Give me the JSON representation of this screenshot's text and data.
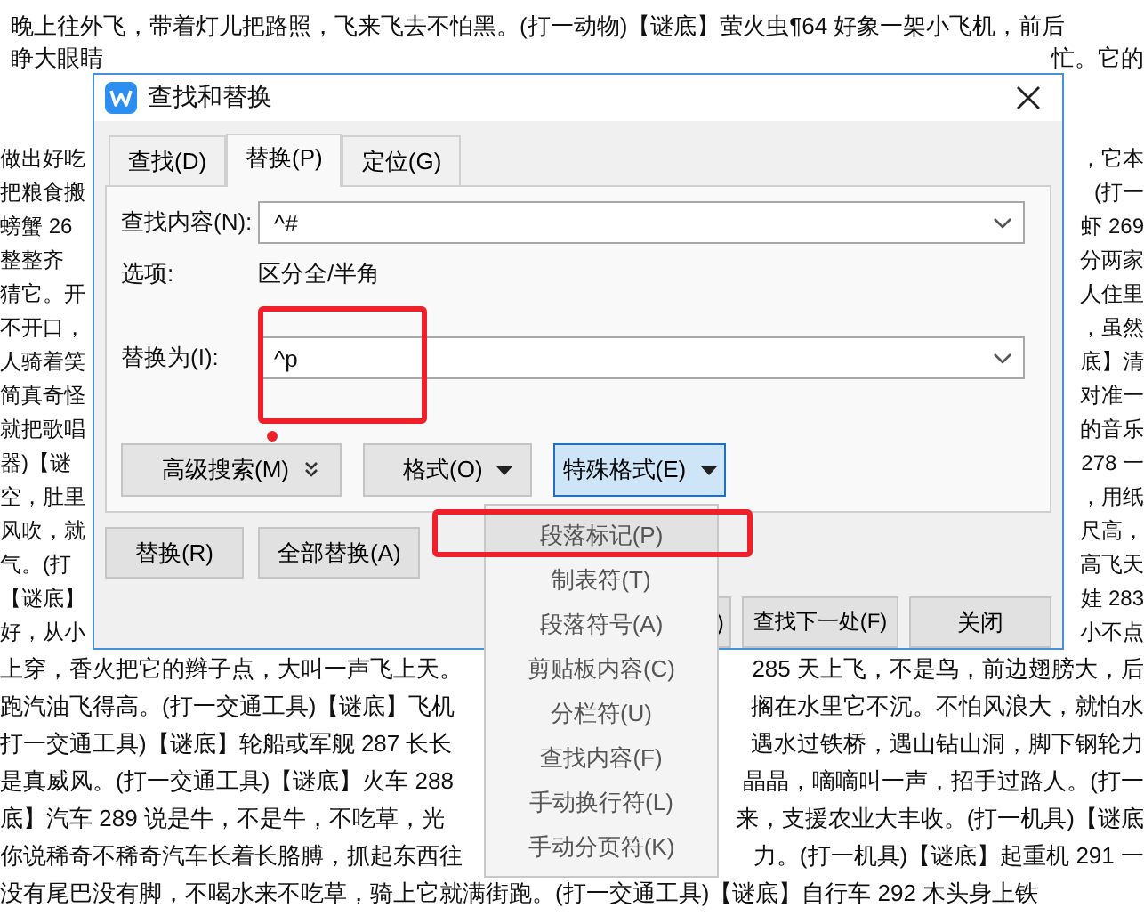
{
  "document": {
    "top_lines": [
      {
        "left": "晚上往外飞，带着灯儿把路照，飞来飞去不怕黑。(打一动物)【谜底】萤火虫¶64  好象一架小飞机，前后"
      },
      {
        "left": "睁大眼睛",
        "right": "忙。它的"
      }
    ],
    "side_lines": [
      {
        "left": "做出好吃",
        "right": "，它本"
      },
      {
        "left": "把粮食搬",
        "right": "(打一"
      },
      {
        "left": "螃蟹 26",
        "right": "虾 269"
      },
      {
        "left": "整整齐",
        "right": "分两家"
      },
      {
        "left": "猜它。开",
        "right": "人住里"
      },
      {
        "left": "不开口，",
        "right": "，虽然"
      },
      {
        "left": "人骑着笑",
        "right": "底】清"
      },
      {
        "left": "简真奇怪",
        "right": "对准一"
      },
      {
        "left": "就把歌唱",
        "right": "的音乐"
      },
      {
        "left": "器)【谜",
        "right": "278 一"
      },
      {
        "left": "空，肚里",
        "right": "，用纸"
      },
      {
        "left": "风吹，就",
        "right": "尺高，"
      },
      {
        "left": "气。(打",
        "right": "高飞天"
      },
      {
        "left": "【谜底】",
        "right": "娃 283"
      },
      {
        "left": "好，从小",
        "right": "小不点"
      }
    ],
    "lower_lines": [
      {
        "left": "上穿，香火把它的辫子点，大叫一声飞上天。",
        "right": "285  天上飞，不是鸟，前边翅膀大，后"
      },
      {
        "left": "跑汽油飞得高。(打一交通工具)【谜底】飞机",
        "right": "搁在水里它不沉。不怕风浪大，就怕水"
      },
      {
        "left": "打一交通工具)【谜底】轮船或军舰 287  长长",
        "right": "遇水过铁桥，遇山钻山洞，脚下钢轮力"
      },
      {
        "left": "是真威风。(打一交通工具)【谜底】火车 288",
        "right": "晶晶，嘀嘀叫一声，招手过路人。(打一"
      },
      {
        "left": "底】汽车 289  说是牛，不是牛，不吃草，光",
        "right": "来，支援农业大丰收。(打一机具)【谜底"
      },
      {
        "left": "你说稀奇不稀奇汽车长着长胳膊，抓起东西往",
        "right": "力。(打一机具)【谜底】起重机 291 一"
      },
      {
        "left": "没有尾巴没有脚，不喝水来不吃草，骑上它就满街跑。(打一交通工具)【谜底】自行车 292  木头身上铁"
      }
    ]
  },
  "dialog": {
    "title": "查找和替换",
    "tabs": [
      {
        "label": "查找(D)",
        "selected": false
      },
      {
        "label": "替换(P)",
        "selected": true
      },
      {
        "label": "定位(G)",
        "selected": false
      }
    ],
    "find": {
      "label": "查找内容(N):",
      "value": "^#"
    },
    "options": {
      "label": "选项:",
      "value": "区分全/半角"
    },
    "replace": {
      "label": "替换为(I):",
      "value": "^p",
      "annotated": true,
      "dot": true
    },
    "format_buttons": [
      {
        "label": "高级搜索(M)",
        "kind": "expand",
        "pressed": false
      },
      {
        "label": "格式(O)",
        "kind": "menu",
        "pressed": false
      },
      {
        "label": "特殊格式(E)",
        "kind": "menu",
        "pressed": true
      }
    ],
    "replace_buttons": [
      "替换(R)",
      "全部替换(A)"
    ],
    "footer_buttons": [
      ")",
      "查找下一处(F)",
      "关闭"
    ]
  },
  "menu": {
    "items": [
      {
        "label": "段落标记(P)",
        "selected": true,
        "annotated": true
      },
      {
        "label": "制表符(T)",
        "selected": false,
        "annotated": false
      },
      {
        "label": "段落符号(A)",
        "selected": false,
        "annotated": false
      },
      {
        "label": "剪贴板内容(C)",
        "selected": false,
        "annotated": false
      },
      {
        "label": "分栏符(U)",
        "selected": false,
        "annotated": false
      },
      {
        "label": "查找内容(F)",
        "selected": false,
        "annotated": false
      },
      {
        "label": "手动换行符(L)",
        "selected": false,
        "annotated": false
      },
      {
        "label": "手动分页符(K)",
        "selected": false,
        "annotated": false
      }
    ]
  }
}
